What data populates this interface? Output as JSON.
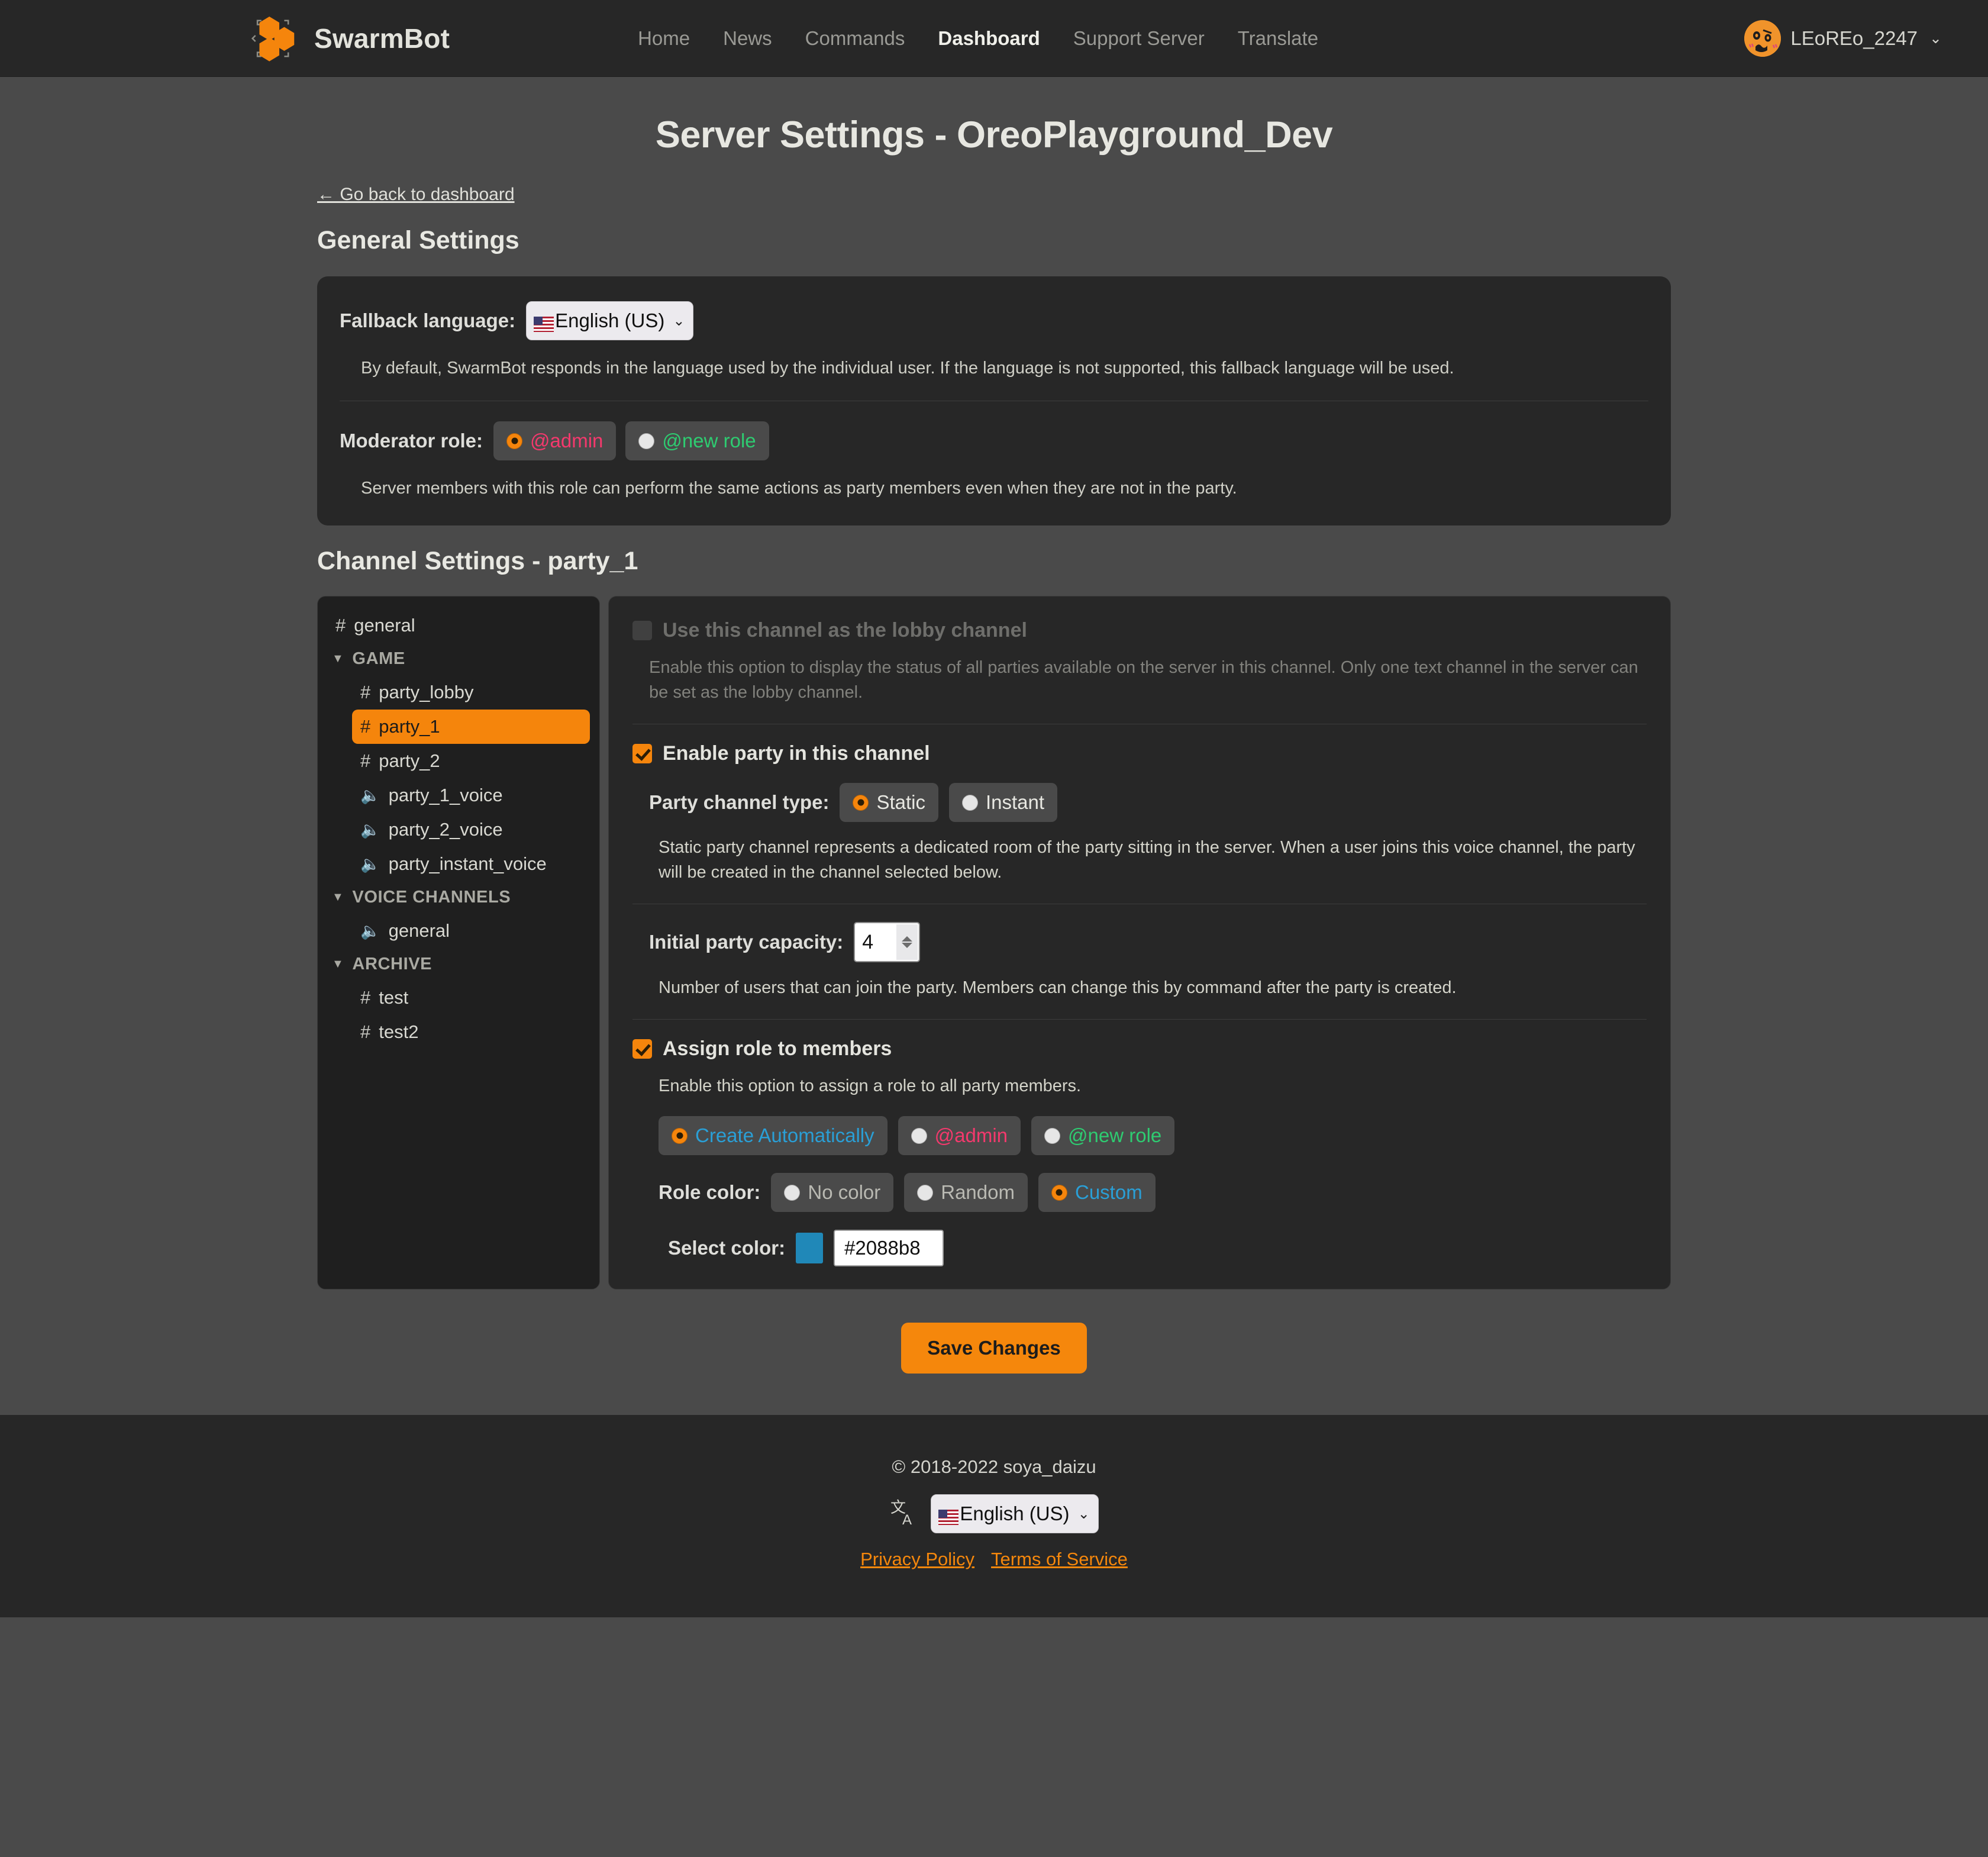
{
  "navbar": {
    "brand": "SwarmBot",
    "logo_icon": "hexagon-cluster-logo",
    "links": [
      {
        "label": "Home",
        "active": false
      },
      {
        "label": "News",
        "active": false
      },
      {
        "label": "Commands",
        "active": false
      },
      {
        "label": "Dashboard",
        "active": true
      },
      {
        "label": "Support Server",
        "active": false
      },
      {
        "label": "Translate",
        "active": false
      }
    ],
    "user": {
      "name": "LEoREo_2247",
      "avatar_icon": "user-avatar",
      "caret": "⌄"
    }
  },
  "page": {
    "title": "Server Settings - OreoPlayground_Dev",
    "back_link": "← Go back to dashboard"
  },
  "general": {
    "heading": "General Settings",
    "fallback_label": "Fallback language:",
    "fallback_value": "English (US)",
    "fallback_help": "By default, SwarmBot responds in the language used by the individual user. If the language is not supported, this fallback language will be used.",
    "moderator_label": "Moderator role:",
    "moderator_options": [
      {
        "label": "@admin",
        "selected": true,
        "color": "#f4396d"
      },
      {
        "label": "@new role",
        "selected": false,
        "color": "#2ecc71"
      }
    ],
    "moderator_help": "Server members with this role can perform the same actions as party members even when they are not in the party."
  },
  "channel_settings": {
    "heading": "Channel Settings - party_1",
    "channels": [
      {
        "label": "general",
        "type": "text",
        "indent": false,
        "selected": false
      },
      {
        "label": "GAME",
        "type": "category",
        "indent": false,
        "selected": false
      },
      {
        "label": "party_lobby",
        "type": "text",
        "indent": true,
        "selected": false
      },
      {
        "label": "party_1",
        "type": "text",
        "indent": true,
        "selected": true
      },
      {
        "label": "party_2",
        "type": "text",
        "indent": true,
        "selected": false
      },
      {
        "label": "party_1_voice",
        "type": "voice",
        "indent": true,
        "selected": false
      },
      {
        "label": "party_2_voice",
        "type": "voice",
        "indent": true,
        "selected": false
      },
      {
        "label": "party_instant_voice",
        "type": "voice",
        "indent": true,
        "selected": false
      },
      {
        "label": "VOICE CHANNELS",
        "type": "category",
        "indent": false,
        "selected": false
      },
      {
        "label": "general",
        "type": "voice",
        "indent": true,
        "selected": false
      },
      {
        "label": "ARCHIVE",
        "type": "category",
        "indent": false,
        "selected": false
      },
      {
        "label": "test",
        "type": "text",
        "indent": true,
        "selected": false
      },
      {
        "label": "test2",
        "type": "text",
        "indent": true,
        "selected": false
      }
    ],
    "lobby": {
      "label": "Use this channel as the lobby channel",
      "checked": false,
      "disabled": true,
      "help": "Enable this option to display the status of all parties available on the server in this channel. Only one text channel in the server can be set as the lobby channel."
    },
    "enable_party": {
      "label": "Enable party in this channel",
      "checked": true
    },
    "party_type": {
      "label": "Party channel type:",
      "options": [
        {
          "label": "Static",
          "selected": true
        },
        {
          "label": "Instant",
          "selected": false
        }
      ],
      "help": "Static party channel represents a dedicated room of the party sitting in the server. When a user joins this voice channel, the party will be created in the channel selected below."
    },
    "capacity": {
      "label": "Initial party capacity:",
      "value": "4",
      "help": "Number of users that can join the party. Members can change this by command after the party is created."
    },
    "assign_role": {
      "label": "Assign role to members",
      "checked": true,
      "help": "Enable this option to assign a role to all party members.",
      "options": [
        {
          "label": "Create Automatically",
          "selected": true,
          "color": "#2a9fd6"
        },
        {
          "label": "@admin",
          "selected": false,
          "color": "#f4396d"
        },
        {
          "label": "@new role",
          "selected": false,
          "color": "#2ecc71"
        }
      ]
    },
    "role_color": {
      "label": "Role color:",
      "options": [
        {
          "label": "No color",
          "selected": false,
          "color": "#b9b9b2"
        },
        {
          "label": "Random",
          "selected": false,
          "color": "#b9b9b2"
        },
        {
          "label": "Custom",
          "selected": true,
          "color": "#2a9fd6"
        }
      ]
    },
    "select_color": {
      "label": "Select color:",
      "swatch": "#2088b8",
      "value": "#2088b8"
    }
  },
  "save_button": "Save Changes",
  "footer": {
    "copyright": "© 2018-2022 soya_daizu",
    "language_value": "English (US)",
    "translate_icon": "translate-icon",
    "links": [
      {
        "label": "Privacy Policy"
      },
      {
        "label": "Terms of Service"
      }
    ]
  }
}
